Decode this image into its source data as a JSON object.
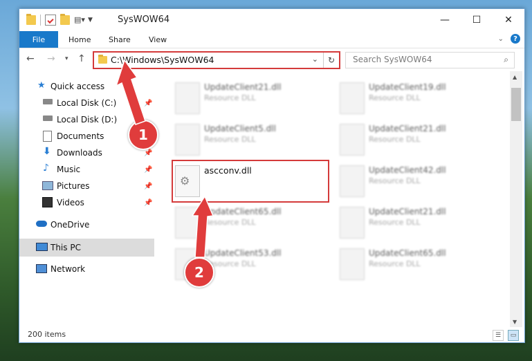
{
  "window": {
    "title": "SysWOW64",
    "controls": {
      "minimize": "—",
      "maximize": "☐",
      "close": "✕"
    }
  },
  "ribbon": {
    "tabs": [
      {
        "label": "File"
      },
      {
        "label": "Home"
      },
      {
        "label": "Share"
      },
      {
        "label": "View"
      }
    ],
    "help": "?"
  },
  "address": {
    "path": "C:\\Windows\\SysWOW64",
    "search_placeholder": "Search SysWOW64"
  },
  "nav_pane": {
    "items": [
      {
        "label": "Quick access"
      },
      {
        "label": "Local Disk (C:)"
      },
      {
        "label": "Local Disk (D:)"
      },
      {
        "label": "Documents"
      },
      {
        "label": "Downloads"
      },
      {
        "label": "Music"
      },
      {
        "label": "Pictures"
      },
      {
        "label": "Videos"
      },
      {
        "label": "OneDrive"
      },
      {
        "label": "This PC"
      },
      {
        "label": "Network"
      }
    ]
  },
  "files": [
    {
      "name": "UpdateClient21.dll",
      "type": "Resource DLL"
    },
    {
      "name": "UpdateClient19.dll",
      "type": "Resource DLL"
    },
    {
      "name": "UpdateClient5.dll",
      "type": "Resource DLL"
    },
    {
      "name": "UpdateClient21.dll",
      "type": "Resource DLL"
    },
    {
      "name": "ascconv.dll",
      "type": ""
    },
    {
      "name": "UpdateClient42.dll",
      "type": "Resource DLL"
    },
    {
      "name": "UpdateClient65.dll",
      "type": "Resource DLL"
    },
    {
      "name": "UpdateClient21.dll",
      "type": "Resource DLL"
    },
    {
      "name": "UpdateClient53.dll",
      "type": "Resource DLL"
    },
    {
      "name": "UpdateClient65.dll",
      "type": "Resource DLL"
    }
  ],
  "status": {
    "items": "200 items"
  },
  "annotations": {
    "step1": "1",
    "step2": "2",
    "color": "#e03c3c"
  }
}
